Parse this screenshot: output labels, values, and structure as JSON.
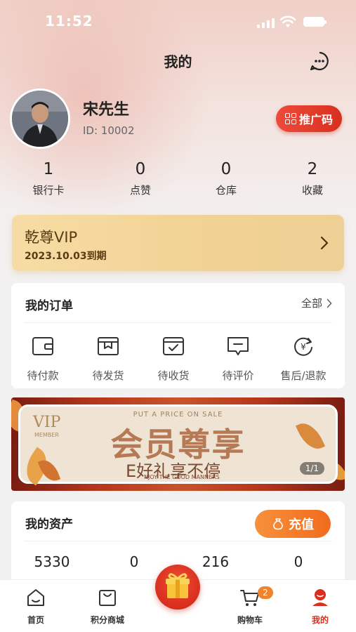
{
  "status_bar": {
    "time": "11:52"
  },
  "header": {
    "title": "我的"
  },
  "profile": {
    "name": "宋先生",
    "id_text": "ID: 10002",
    "promo_label": "推广码"
  },
  "stats": [
    {
      "value": "1",
      "label": "银行卡"
    },
    {
      "value": "0",
      "label": "点赞"
    },
    {
      "value": "0",
      "label": "仓库"
    },
    {
      "value": "2",
      "label": "收藏"
    }
  ],
  "vip": {
    "title": "乾尊VIP",
    "expiry": "2023.10.03到期"
  },
  "orders": {
    "title": "我的订单",
    "all_label": "全部",
    "items": [
      {
        "label": "待付款",
        "icon": "wallet-icon"
      },
      {
        "label": "待发货",
        "icon": "box-icon"
      },
      {
        "label": "待收货",
        "icon": "receive-icon"
      },
      {
        "label": "待评价",
        "icon": "comment-icon"
      },
      {
        "label": "售后/退款",
        "icon": "refund-icon"
      }
    ]
  },
  "banner": {
    "vip_text": "VIP",
    "member_text": "MEMBER",
    "tagline": "PUT A PRICE ON SALE",
    "headline": "会员尊享",
    "subline": "E好礼享不停",
    "subline_en": "NJOY THE GOOD MANNERS",
    "pager": "1/1"
  },
  "assets": {
    "title": "我的资产",
    "recharge_label": "充值",
    "values": [
      "5330",
      "0",
      "216",
      "0"
    ]
  },
  "tabbar": {
    "items": [
      {
        "label": "首页",
        "icon": "home-icon"
      },
      {
        "label": "积分商城",
        "icon": "mall-icon"
      },
      {
        "label": "购物车",
        "icon": "cart-icon",
        "badge": "2"
      },
      {
        "label": "我的",
        "icon": "profile-icon",
        "active": true
      }
    ],
    "center_icon": "gift-icon"
  },
  "colors": {
    "accent": "#d8301f",
    "vip_gold": "#f2d294",
    "recharge_orange": "#f06b1d"
  }
}
